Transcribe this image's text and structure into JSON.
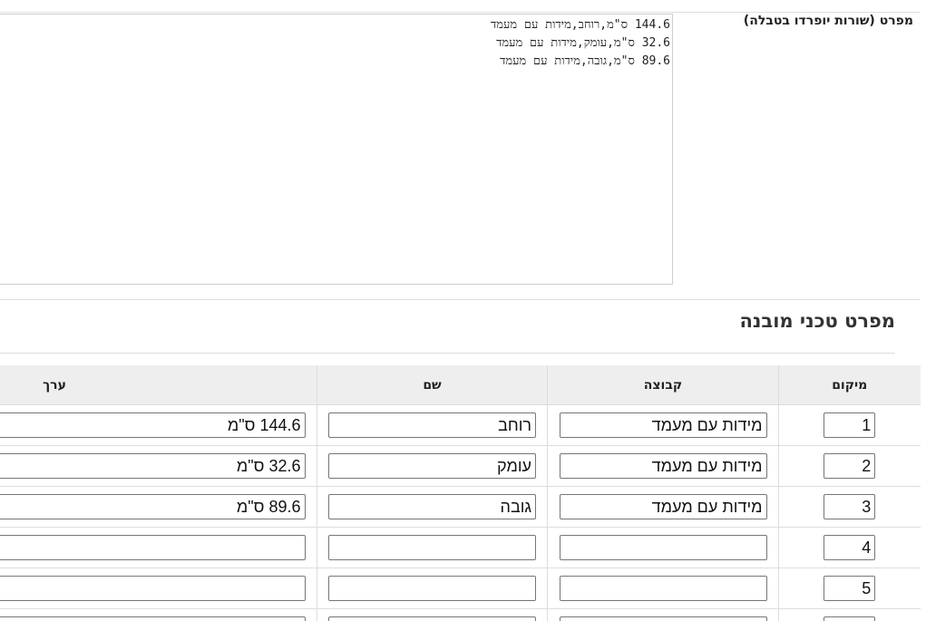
{
  "spec_section": {
    "label": "מפרט (שורות יופרדו בטבלה)",
    "text": "144.6 ס\"מ,רוחב,מידות עם מעמד\n32.6 ס\"מ,עומק,מידות עם מעמד\n89.6 ס\"מ,גובה,מידות עם מעמד"
  },
  "structured": {
    "title": "מפרט טכני מובנה",
    "headers": {
      "position": "מיקום",
      "group": "קבוצה",
      "name": "שם",
      "value": "ערך"
    },
    "rows": [
      {
        "position": "1",
        "group": "מידות עם מעמד",
        "name": "רוחב",
        "value": "144.6 ס\"מ"
      },
      {
        "position": "2",
        "group": "מידות עם מעמד",
        "name": "עומק",
        "value": "32.6 ס\"מ"
      },
      {
        "position": "3",
        "group": "מידות עם מעמד",
        "name": "גובה",
        "value": "89.6 ס\"מ"
      },
      {
        "position": "4",
        "group": "",
        "name": "",
        "value": ""
      },
      {
        "position": "5",
        "group": "",
        "name": "",
        "value": ""
      },
      {
        "position": "",
        "group": "",
        "name": "",
        "value": ""
      }
    ]
  }
}
